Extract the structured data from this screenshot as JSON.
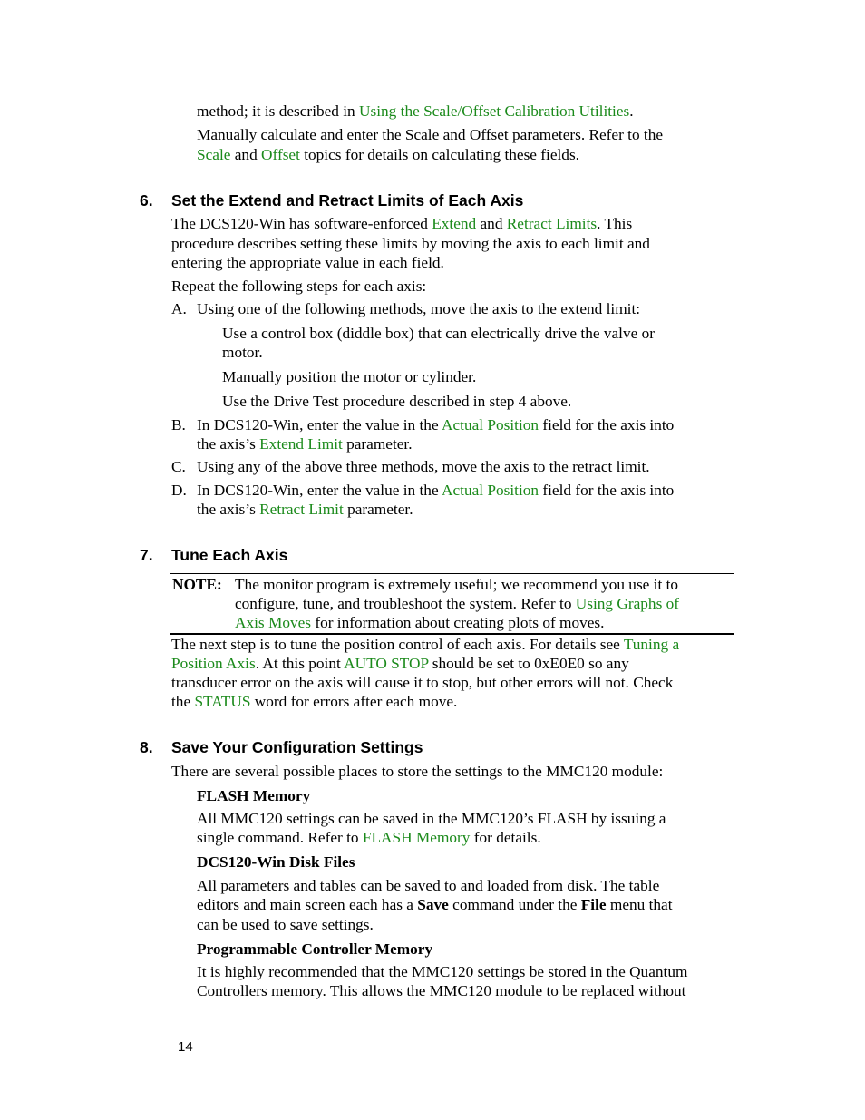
{
  "intro": {
    "line1": {
      "pre": "method; it is described in ",
      "link": "Using the Scale/Offset Calibration Utilities",
      "post": "."
    },
    "line2": "Manually calculate and enter the Scale and Offset parameters.  Refer to the",
    "line3": {
      "link1": "Scale",
      "mid": " and ",
      "link2": "Offset",
      "post": " topics for details on calculating these fields."
    }
  },
  "step6": {
    "number": "6.",
    "title": "Set the Extend and Retract Limits of Each Axis",
    "p1_l1": {
      "pre": "The DCS120-Win has software-enforced ",
      "link1": "Extend",
      "mid": " and ",
      "link2": "Retract Limits",
      "post": ".  This"
    },
    "p1_l2": "procedure describes setting these limits by moving the axis to each limit and",
    "p1_l3": "entering the appropriate value in each field.",
    "p2": "Repeat the following steps for each axis:",
    "A": {
      "marker": "A.",
      "text": "Using one of the following methods, move the axis to the extend limit:"
    },
    "methods": [
      "Use a control box (diddle box) that can electrically drive the valve or",
      "motor.",
      "Manually position the motor or cylinder.",
      "Use the Drive Test procedure described in step 4 above."
    ],
    "B": {
      "marker": "B.",
      "l1_pre": "In DCS120-Win, enter the value in the ",
      "l1_link": "Actual Position",
      "l1_post": " field for the axis into",
      "l2_pre": "the axis’s ",
      "l2_link": "Extend Limit",
      "l2_post": " parameter."
    },
    "C": {
      "marker": "C.",
      "text": "Using any of the above three methods, move the axis to the retract limit."
    },
    "D": {
      "marker": "D.",
      "l1_pre": "In DCS120-Win, enter the value in the ",
      "l1_link": "Actual Position",
      "l1_post": " field for the axis into",
      "l2_pre": "the axis’s ",
      "l2_link": "Retract Limit",
      "l2_post": " parameter."
    }
  },
  "step7": {
    "number": "7.",
    "title": "Tune Each Axis",
    "note": {
      "label": "NOTE:",
      "l1": "The monitor program is extremely useful; we recommend you use it to",
      "l2_pre": "configure, tune, and troubleshoot the system.  Refer to ",
      "l2_link": "Using Graphs of",
      "l3_link": "Axis Moves",
      "l3_post": " for information about creating plots of moves."
    },
    "p_l1_pre": "The next step is to tune the position control of each axis.  For details see ",
    "p_l1_link": "Tuning a",
    "p_l2_link": "Position Axis",
    "p_l2_mid": ".  At this point ",
    "p_l2_link2": "AUTO STOP",
    "p_l2_post": " should be set to 0xE0E0 so any",
    "p_l3": "transducer error on the axis will cause it to stop, but other errors will not.  Check",
    "p_l4_pre": "the ",
    "p_l4_link": "STATUS",
    "p_l4_post": " word for errors after each move."
  },
  "step8": {
    "number": "8.",
    "title": "Save Your Configuration Settings",
    "intro": "There are several possible places to store the settings to the MMC120 module:",
    "flash": {
      "heading": "FLASH Memory",
      "l1": "All MMC120 settings can be saved in the MMC120’s FLASH by issuing a",
      "l2_pre": "single command.  Refer to ",
      "l2_link": "FLASH Memory",
      "l2_post": " for details."
    },
    "disk": {
      "heading": "DCS120-Win Disk Files",
      "l1": "All parameters and tables can be saved to and loaded from disk.  The table",
      "l2_pre": "editors and main screen each has a ",
      "l2_b1": "Save",
      "l2_mid": " command under the ",
      "l2_b2": "File",
      "l2_post": " menu that",
      "l3": "can be used to save settings."
    },
    "plc": {
      "heading": "Programmable Controller Memory",
      "l1": "It is highly recommended that the MMC120 settings be stored in the Quantum",
      "l2": "Controllers memory.  This allows the MMC120 module to be replaced without"
    }
  },
  "footer": {
    "page_number": "14"
  },
  "colors": {
    "link": "#1b8a1b",
    "text": "#000000"
  }
}
